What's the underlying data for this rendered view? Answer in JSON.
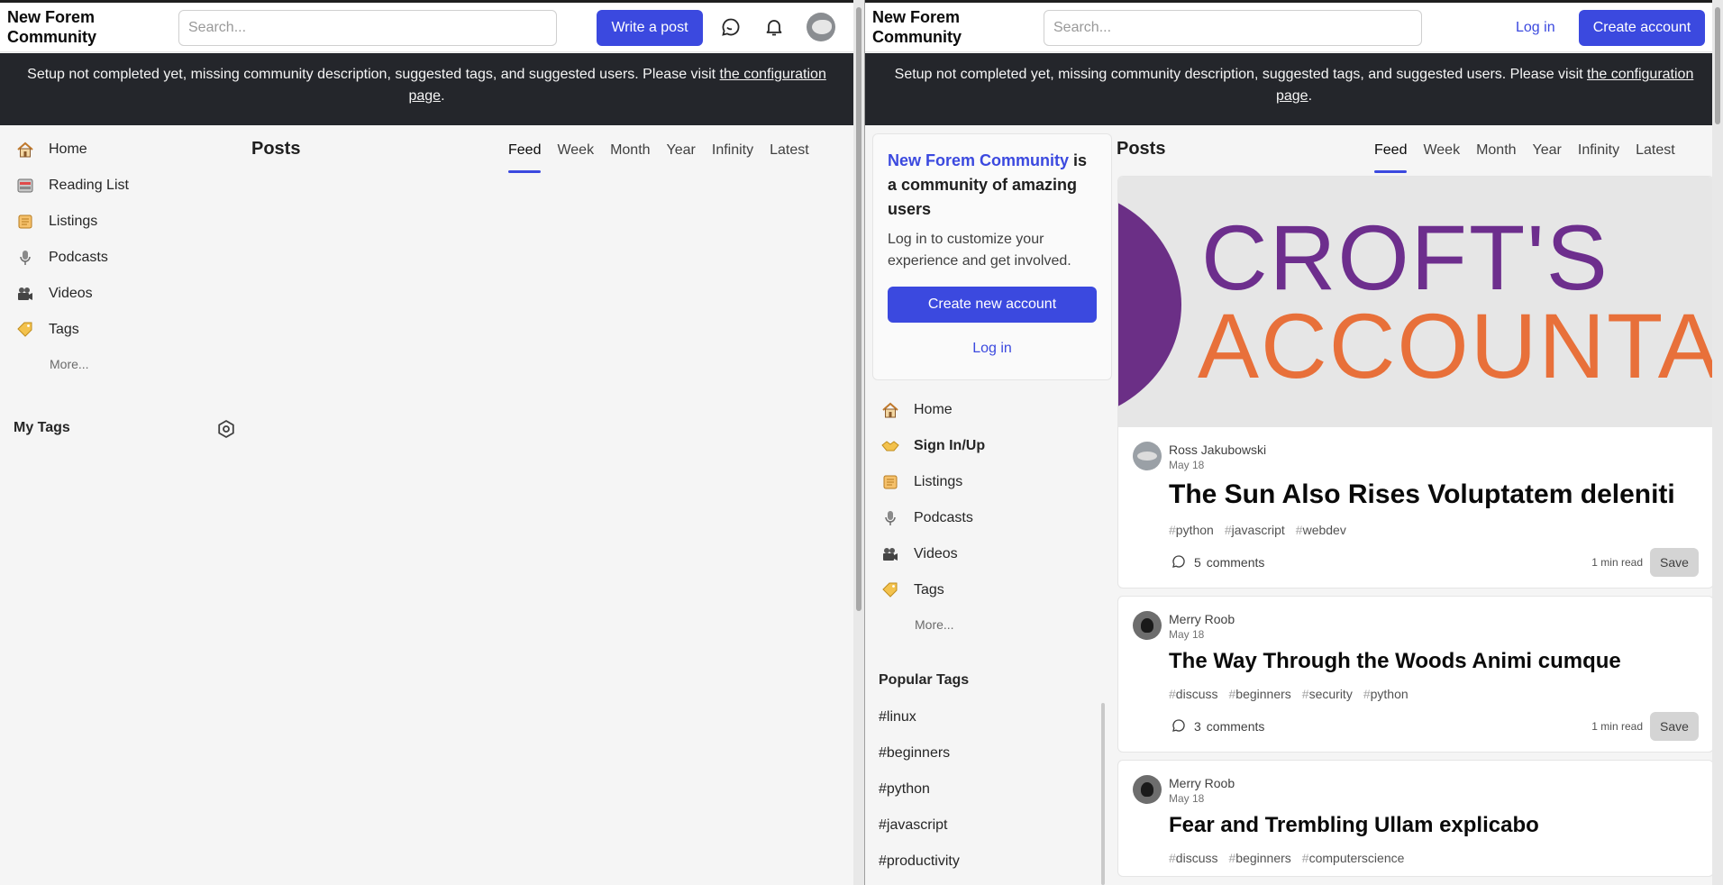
{
  "left": {
    "logo": "New Forem Community",
    "search_placeholder": "Search...",
    "write_post": "Write a post",
    "banner_text": "Setup not completed yet, missing community description, suggested tags, and suggested users. Please visit ",
    "banner_link": "the configuration page",
    "banner_end": ".",
    "nav": [
      {
        "label": "Home",
        "icon": "house-icon"
      },
      {
        "label": "Reading List",
        "icon": "reading-list-icon"
      },
      {
        "label": "Listings",
        "icon": "scroll-icon"
      },
      {
        "label": "Podcasts",
        "icon": "microphone-icon"
      },
      {
        "label": "Videos",
        "icon": "camera-icon"
      },
      {
        "label": "Tags",
        "icon": "tag-icon"
      }
    ],
    "more": "More...",
    "my_tags": "My Tags",
    "posts_heading": "Posts",
    "tabs": [
      "Feed",
      "Week",
      "Month",
      "Year",
      "Infinity",
      "Latest"
    ]
  },
  "right": {
    "logo": "New Forem Community",
    "search_placeholder": "Search...",
    "login": "Log in",
    "create_account": "Create account",
    "banner_text": "Setup not completed yet, missing community description, suggested tags, and suggested users. Please visit ",
    "banner_link": "the configuration page",
    "banner_end": ".",
    "cta": {
      "brand": "New Forem Community",
      "title_rest": " is a community of amazing users",
      "body": "Log in to customize your experience and get involved.",
      "create": "Create new account",
      "login": "Log in"
    },
    "nav": [
      {
        "label": "Home",
        "icon": "house-icon"
      },
      {
        "label": "Sign In/Up",
        "icon": "handshake-icon"
      },
      {
        "label": "Listings",
        "icon": "scroll-icon"
      },
      {
        "label": "Podcasts",
        "icon": "microphone-icon"
      },
      {
        "label": "Videos",
        "icon": "camera-icon"
      },
      {
        "label": "Tags",
        "icon": "tag-icon"
      }
    ],
    "more": "More...",
    "popular_title": "Popular Tags",
    "popular_tags": [
      "#linux",
      "#beginners",
      "#python",
      "#javascript",
      "#productivity"
    ],
    "posts_heading": "Posts",
    "tabs": [
      "Feed",
      "Week",
      "Month",
      "Year",
      "Infinity",
      "Latest"
    ],
    "cover": {
      "line1": "CROFT'S",
      "line2": "ACCOUNTA"
    },
    "posts": [
      {
        "author": "Ross Jakubowski",
        "date": "May 18",
        "title": "The Sun Also Rises Voluptatem deleniti",
        "tags": [
          "python",
          "javascript",
          "webdev"
        ],
        "comments": "5",
        "comments_label": "comments",
        "read_time": "1 min read",
        "save": "Save"
      },
      {
        "author": "Merry Roob",
        "date": "May 18",
        "title": "The Way Through the Woods Animi cumque",
        "tags": [
          "discuss",
          "beginners",
          "security",
          "python"
        ],
        "comments": "3",
        "comments_label": "comments",
        "read_time": "1 min read",
        "save": "Save"
      },
      {
        "author": "Merry Roob",
        "date": "May 18",
        "title": "Fear and Trembling Ullam explicabo",
        "tags": [
          "discuss",
          "beginners",
          "computerscience"
        ]
      }
    ]
  },
  "colors": {
    "accent": "#3b49df",
    "banner_bg": "#24262b"
  }
}
